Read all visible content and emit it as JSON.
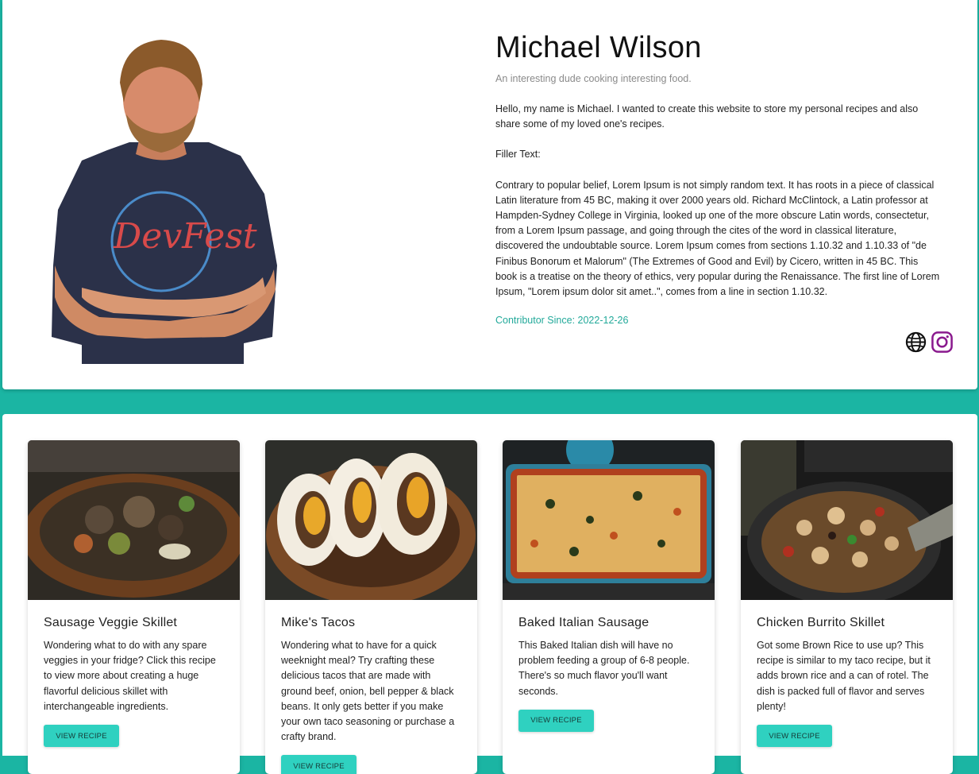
{
  "profile": {
    "name": "Michael Wilson",
    "tagline": "An interesting dude cooking interesting food.",
    "bio": [
      "Hello, my name is Michael. I wanted to create this website to store my personal recipes and also share some of my loved one's recipes.",
      "Filler Text:",
      "Contrary to popular belief, Lorem Ipsum is not simply random text. It has roots in a piece of classical Latin literature from 45 BC, making it over 2000 years old. Richard McClintock, a Latin professor at Hampden-Sydney College in Virginia, looked up one of the more obscure Latin words, consectetur, from a Lorem Ipsum passage, and going through the cites of the word in classical literature, discovered the undoubtable source. Lorem Ipsum comes from sections 1.10.32 and 1.10.33 of \"de Finibus Bonorum et Malorum\" (The Extremes of Good and Evil) by Cicero, written in 45 BC. This book is a treatise on the theory of ethics, very popular during the Renaissance. The first line of Lorem Ipsum, \"Lorem ipsum dolor sit amet..\", comes from a line in section 1.10.32."
    ],
    "contributor_since": "Contributor Since: 2022-12-26",
    "socials": [
      {
        "icon": "globe-icon",
        "color": "#111111"
      },
      {
        "icon": "instagram-icon",
        "color": "#8a1a8e"
      }
    ]
  },
  "recipes": [
    {
      "title": "Sausage Veggie Skillet",
      "description": "Wondering what to do with any spare veggies in your fridge? Click this recipe to view more about creating a huge flavorful delicious skillet with interchangeable ingredients.",
      "button": "VIEW RECIPE"
    },
    {
      "title": "Mike's Tacos",
      "description": "Wondering what to have for a quick weeknight meal? Try crafting these delicious tacos that are made with ground beef, onion, bell pepper & black beans. It only gets better if you make your own taco seasoning or purchase a crafty brand.",
      "button": "VIEW RECIPE"
    },
    {
      "title": "Baked Italian Sausage",
      "description": "This Baked Italian dish will have no problem feeding a group of 6-8 people. There's so much flavor you'll want seconds.",
      "button": "VIEW RECIPE"
    },
    {
      "title": "Chicken Burrito Skillet",
      "description": "Got some Brown Rice to use up? This recipe is similar to my taco recipe, but it adds brown rice and a can of rotel. The dish is packed full of flavor and serves plenty!",
      "button": "VIEW RECIPE"
    }
  ],
  "colors": {
    "background": "#1bb5a3",
    "accent": "#2fd1c0",
    "contributor_text": "#22a99a"
  }
}
